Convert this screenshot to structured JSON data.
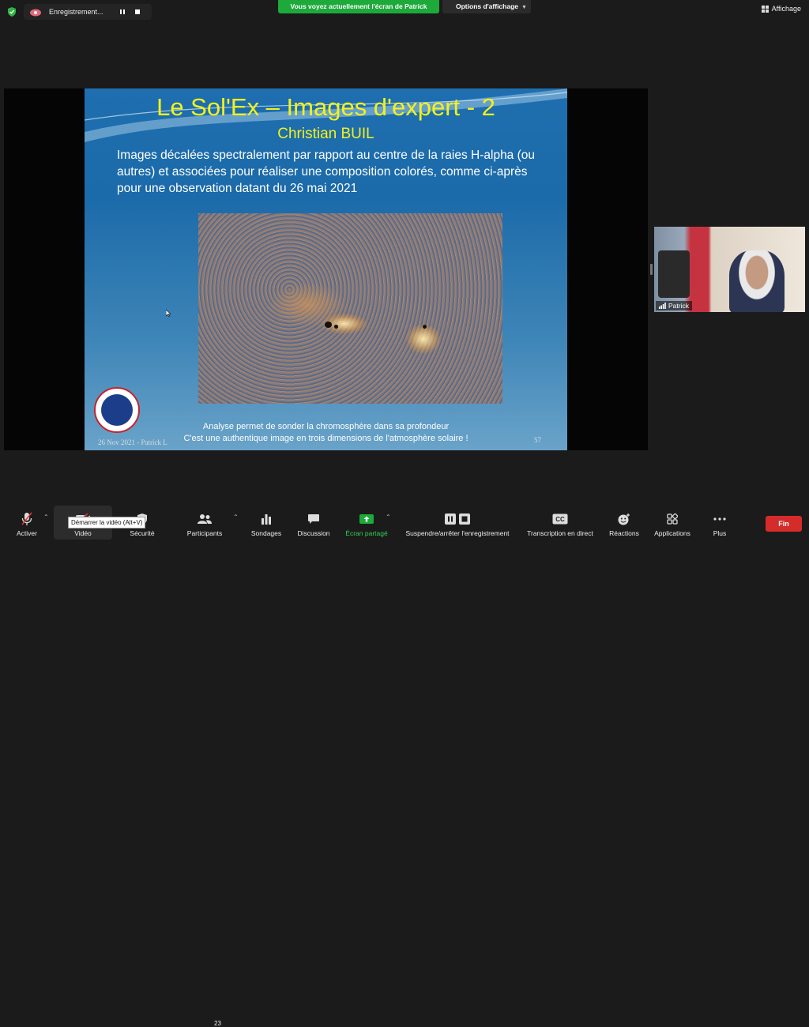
{
  "top_bar": {
    "recording_label": "Enregistrement...",
    "banner": "Vous voyez actuellement l'écran de Patrick",
    "view_options": "Options d'affichage",
    "layout_label": "Affichage"
  },
  "slide": {
    "title": "Le Sol'Ex – Images d'expert - 2",
    "author": "Christian BUIL",
    "body": "Images décalées spectralement par rapport au centre de la raies H-alpha (ou autres) et associées pour réaliser une composition colorés, comme  ci-après pour une observation datant du 26 mai 2021",
    "caption_line1": "Analyse permet de sonder la chromosphère dans sa profondeur",
    "caption_line2": "C'est une authentique image en trois dimensions de l'atmosphère solaire !",
    "date": "26 Nov 2021 - Patrick L",
    "page_number": "57"
  },
  "participant": {
    "name": "Patrick"
  },
  "toolbar": {
    "mute": "Activer",
    "video": "Vidéo",
    "security": "Sécurité",
    "participants": "Participants",
    "participants_count": "23",
    "polls": "Sondages",
    "chat": "Discussion",
    "share": "Écran partagé",
    "record": "Suspendre/arrêter l'enregistrement",
    "transcript": "Transcription en direct",
    "reactions": "Réactions",
    "apps": "Applications",
    "more": "Plus",
    "end": "Fin",
    "video_tooltip": "Démarrer la vidéo (Alt+V)",
    "cc_badge": "CC"
  },
  "colors": {
    "share_green": "#1ea93b",
    "end_red": "#d62b2b",
    "slide_title_yellow": "#f5f11a"
  }
}
